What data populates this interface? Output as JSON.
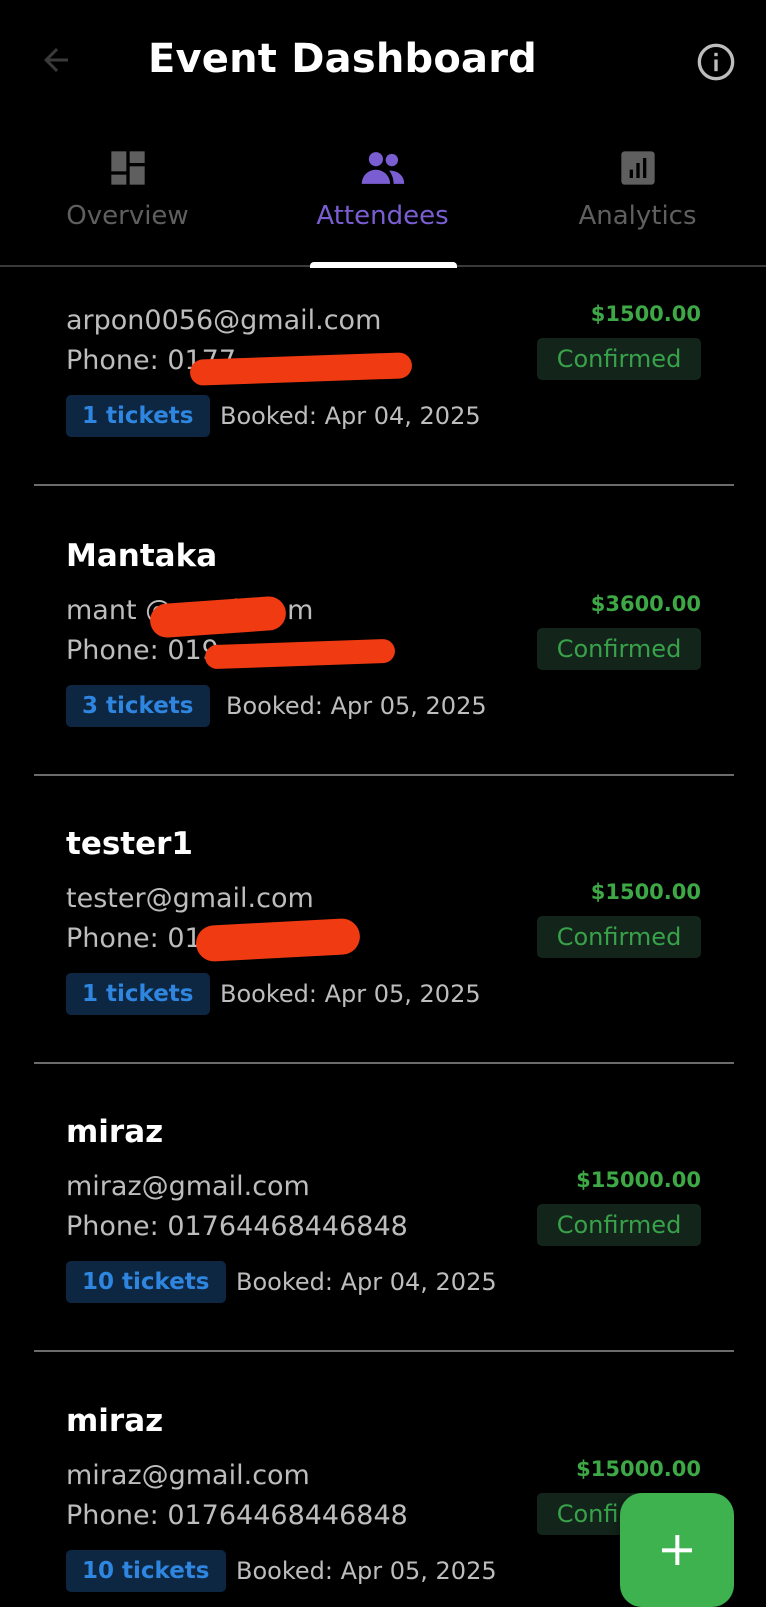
{
  "app_bar": {
    "title": "Event Dashboard",
    "back_icon": "arrow-left-icon",
    "info_icon": "info-icon"
  },
  "tabs": [
    {
      "label": "Overview",
      "icon": "dashboard-icon",
      "active": false
    },
    {
      "label": "Attendees",
      "icon": "people-icon",
      "active": true
    },
    {
      "label": "Analytics",
      "icon": "analytics-icon",
      "active": false
    }
  ],
  "colors": {
    "accent_purple": "#7a5ed1",
    "amount_green": "#3da845",
    "ticket_blue": "#2e86e0",
    "fab_green": "#3db24e",
    "redaction_red": "#f03a12"
  },
  "attendees": [
    {
      "name": "",
      "email": "arpon0056@gmail.com",
      "phone": "Phone: 0177",
      "tickets": "1 tickets",
      "booked": "Booked: Apr 04, 2025",
      "amount": "$1500.00",
      "status": "Confirmed"
    },
    {
      "name": "Mantaka",
      "email": "mant               @gmail.com",
      "phone": "Phone: 019",
      "tickets": "3 tickets",
      "booked": "Booked: Apr 05, 2025",
      "amount": "$3600.00",
      "status": "Confirmed"
    },
    {
      "name": "tester1",
      "email": "tester@gmail.com",
      "phone": "Phone: 01",
      "tickets": "1 tickets",
      "booked": "Booked: Apr 05, 2025",
      "amount": "$1500.00",
      "status": "Confirmed"
    },
    {
      "name": "miraz",
      "email": "miraz@gmail.com",
      "phone": "Phone: 01764468446848",
      "tickets": "10 tickets",
      "booked": "Booked: Apr 04, 2025",
      "amount": "$15000.00",
      "status": "Confirmed"
    },
    {
      "name": "miraz",
      "email": "miraz@gmail.com",
      "phone": "Phone: 01764468446848",
      "tickets": "10 tickets",
      "booked": "Booked: Apr 05, 2025",
      "amount": "$15000.00",
      "status": "Confirmed"
    }
  ],
  "fab": {
    "icon": "plus-icon"
  }
}
